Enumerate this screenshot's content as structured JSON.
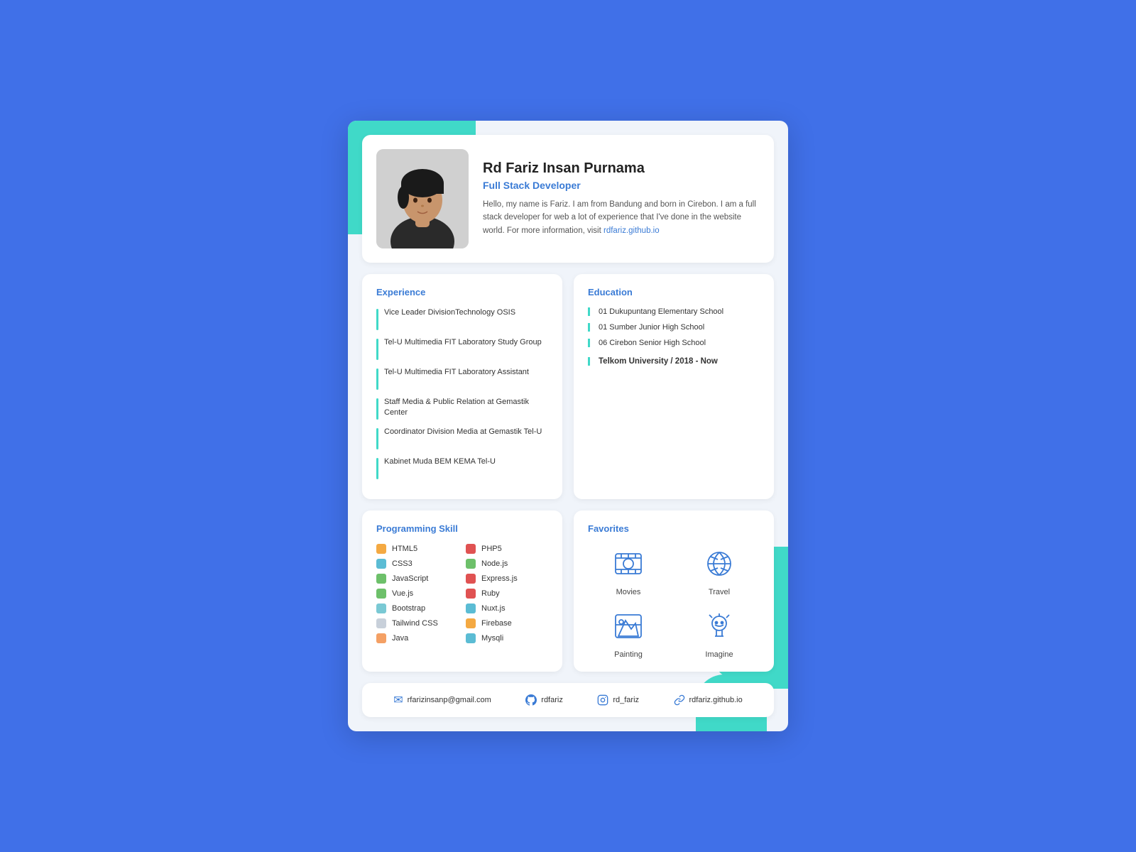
{
  "header": {
    "name": "Rd Fariz Insan Purnama",
    "title": "Full Stack Developer",
    "bio": "Hello, my name is Fariz. I am from Bandung and born in Cirebon. I am a full stack developer for web a lot of experience that I've done in the website world. For more information, visit",
    "link": "rdfariz.github.io"
  },
  "experience": {
    "title": "Experience",
    "items": [
      "Vice Leader DivisionTechnology OSIS",
      "Tel-U Multimedia FIT Laboratory Study Group",
      "Tel-U Multimedia FIT Laboratory Assistant",
      "Staff Media & Public Relation at Gemastik Center",
      "Coordinator Division Media at Gemastik Tel-U",
      "Kabinet Muda BEM KEMA Tel-U"
    ]
  },
  "education": {
    "title": "Education",
    "items": [
      "01 Dukupuntang Elementary School",
      "01 Sumber Junior High School",
      "06 Cirebon Senior High School"
    ],
    "highlight": "Telkom University / 2018 - Now"
  },
  "skills": {
    "title": "Programming Skill",
    "items": [
      {
        "name": "HTML5",
        "color": "#f4a942"
      },
      {
        "name": "PHP5",
        "color": "#e05252"
      },
      {
        "name": "CSS3",
        "color": "#5bbcd4"
      },
      {
        "name": "Node.js",
        "color": "#6dc06a"
      },
      {
        "name": "JavaScript",
        "color": "#6dc06a"
      },
      {
        "name": "Express.js",
        "color": "#e05252"
      },
      {
        "name": "Vue.js",
        "color": "#6dc06a"
      },
      {
        "name": "Ruby",
        "color": "#e05252"
      },
      {
        "name": "Bootstrap",
        "color": "#7ac9d4"
      },
      {
        "name": "Nuxt.js",
        "color": "#5bbcd4"
      },
      {
        "name": "Tailwind CSS",
        "color": "#c8d0da"
      },
      {
        "name": "Firebase",
        "color": "#f4a942"
      },
      {
        "name": "Java",
        "color": "#f4a064"
      },
      {
        "name": "Mysqli",
        "color": "#5bbcd4"
      }
    ]
  },
  "favorites": {
    "title": "Favorites",
    "items": [
      {
        "label": "Movies",
        "icon": "movies"
      },
      {
        "label": "Travel",
        "icon": "travel"
      },
      {
        "label": "Painting",
        "icon": "painting"
      },
      {
        "label": "Imagine",
        "icon": "imagine"
      }
    ]
  },
  "footer": {
    "email": "rfarizinsanp@gmail.com",
    "github": "rdfariz",
    "instagram": "rd_fariz",
    "website": "rdfariz.github.io"
  }
}
